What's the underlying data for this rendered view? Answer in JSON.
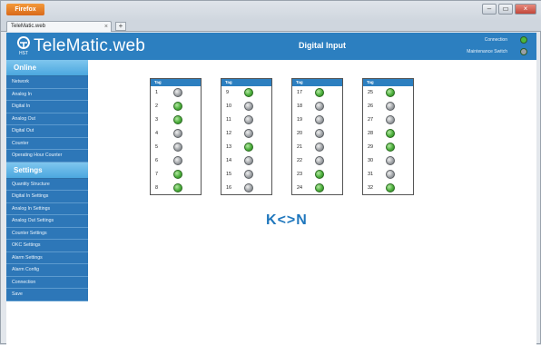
{
  "browser": {
    "app_button": "Firefox",
    "tab_title": "TeleMatic.web",
    "tab_close": "×",
    "new_tab": "+",
    "window_controls": [
      "–",
      "▭",
      "×"
    ]
  },
  "header": {
    "logo_icon_text": "HST",
    "logo_text": "TeleMatic.web",
    "title": "Digital Input",
    "connection_label": "Connection",
    "connection_color": "#4cb63c",
    "maintenance_label": "Maintenance Switch",
    "maintenance_color": "#9aa0a6"
  },
  "sidebar": {
    "online_label": "Online",
    "online_items": [
      "Network",
      "Analog In",
      "Digital In",
      "Analog Out",
      "Digital Out",
      "Counter",
      "Operating Hour Counter"
    ],
    "settings_label": "Settings",
    "settings_items": [
      "Quantity Structure",
      "Digital In Settings",
      "Analog In Settings",
      "Analog Out Settings",
      "Counter Settings",
      "OKC Settings",
      "Alarm Settings",
      "Alarm Config",
      "Connection",
      "Save"
    ]
  },
  "panels": [
    {
      "head": "Tag",
      "rows": [
        {
          "n": "1",
          "on": false
        },
        {
          "n": "2",
          "on": true
        },
        {
          "n": "3",
          "on": true
        },
        {
          "n": "4",
          "on": false
        },
        {
          "n": "5",
          "on": false
        },
        {
          "n": "6",
          "on": false
        },
        {
          "n": "7",
          "on": true
        },
        {
          "n": "8",
          "on": true
        }
      ]
    },
    {
      "head": "Tag",
      "rows": [
        {
          "n": "9",
          "on": true
        },
        {
          "n": "10",
          "on": false
        },
        {
          "n": "11",
          "on": false
        },
        {
          "n": "12",
          "on": false
        },
        {
          "n": "13",
          "on": true
        },
        {
          "n": "14",
          "on": false
        },
        {
          "n": "15",
          "on": false
        },
        {
          "n": "16",
          "on": false
        }
      ]
    },
    {
      "head": "Tag",
      "rows": [
        {
          "n": "17",
          "on": true
        },
        {
          "n": "18",
          "on": false
        },
        {
          "n": "19",
          "on": false
        },
        {
          "n": "20",
          "on": false
        },
        {
          "n": "21",
          "on": false
        },
        {
          "n": "22",
          "on": false
        },
        {
          "n": "23",
          "on": true
        },
        {
          "n": "24",
          "on": true
        }
      ]
    },
    {
      "head": "Tag",
      "rows": [
        {
          "n": "25",
          "on": true
        },
        {
          "n": "26",
          "on": false
        },
        {
          "n": "27",
          "on": false
        },
        {
          "n": "28",
          "on": true
        },
        {
          "n": "29",
          "on": true
        },
        {
          "n": "30",
          "on": false
        },
        {
          "n": "31",
          "on": false
        },
        {
          "n": "32",
          "on": true
        }
      ]
    }
  ],
  "pager": {
    "first": "K",
    "prev": "<",
    "next": ">",
    "last": "N"
  }
}
